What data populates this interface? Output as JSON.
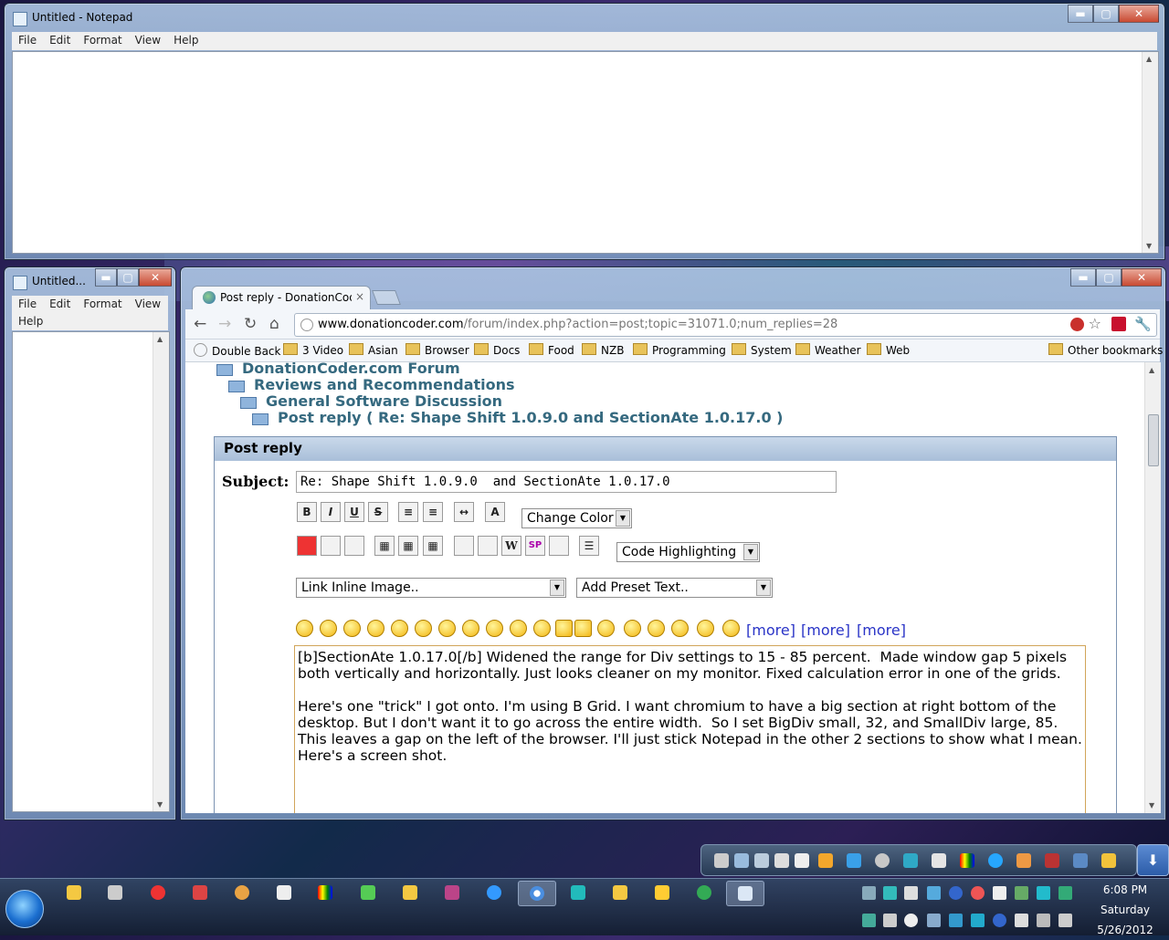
{
  "notepad_top": {
    "title": "Untitled - Notepad",
    "menu": [
      "File",
      "Edit",
      "Format",
      "View",
      "Help"
    ]
  },
  "notepad_small": {
    "title": "Untitled...",
    "menu": [
      "File",
      "Edit",
      "Format",
      "View",
      "Help"
    ]
  },
  "caption_buttons": {
    "minimize": "▬",
    "maximize": "▢",
    "close": "✕"
  },
  "chrome": {
    "tab_title": "Post reply - DonationCoder",
    "tab_close": "×",
    "url_host": "www.donationcoder.com",
    "url_path": "/forum/index.php?action=post;topic=31071.0;num_replies=28",
    "bookmarks": [
      {
        "label": "Double Back",
        "icon": "page-icon"
      },
      {
        "label": "3 Video",
        "icon": "folder-icon"
      },
      {
        "label": "Asian",
        "icon": "folder-icon"
      },
      {
        "label": "Browser",
        "icon": "folder-icon"
      },
      {
        "label": "Docs",
        "icon": "folder-icon"
      },
      {
        "label": "Food",
        "icon": "folder-icon"
      },
      {
        "label": "NZB",
        "icon": "folder-icon"
      },
      {
        "label": "Programming",
        "icon": "folder-icon"
      },
      {
        "label": "System",
        "icon": "folder-icon"
      },
      {
        "label": "Weather",
        "icon": "folder-icon"
      },
      {
        "label": "Web",
        "icon": "folder-icon"
      }
    ],
    "other_bookmarks": "Other bookmarks"
  },
  "forum": {
    "breadcrumbs": [
      "DonationCoder.com Forum",
      "Reviews and Recommendations",
      "General Software Discussion",
      "Post reply ( Re: Shape Shift 1.0.9.0 and SectionAte 1.0.17.0 )"
    ],
    "panel_title": "Post reply",
    "subject_label": "Subject:",
    "subject_value": "Re: Shape Shift 1.0.9.0  and SectionAte 1.0.17.0",
    "format_buttons": [
      "B",
      "I",
      "U",
      "S"
    ],
    "change_color": "Change Color",
    "code_highlighting": "Code Highlighting",
    "link_inline_image": "Link Inline Image..",
    "add_preset_text": "Add Preset Text..",
    "more_links": [
      "[more]",
      "[more]",
      "[more]"
    ],
    "message": "[b]SectionAte 1.0.17.0[/b] Widened the range for Div settings to 15 - 85 percent.  Made window gap 5 pixels both vertically and horizontally. Just looks cleaner on my monitor. Fixed calculation error in one of the grids.\n\nHere's one \"trick\" I got onto. I'm using B Grid. I want chromium to have a big section at right bottom of the desktop. But I don't want it to go across the entire width.  So I set BigDiv small, 32, and SmallDiv large, 85.  This leaves a gap on the left of the browser. I'll just stick Notepad in the other 2 sections to show what I mean.  Here's a screen shot."
  },
  "clock": {
    "time": "6:08 PM",
    "day": "Saturday",
    "date": "5/26/2012"
  },
  "colors": {
    "accent": "#35697f",
    "link": "#2a34c7",
    "panel_border": "#7b93b2"
  }
}
